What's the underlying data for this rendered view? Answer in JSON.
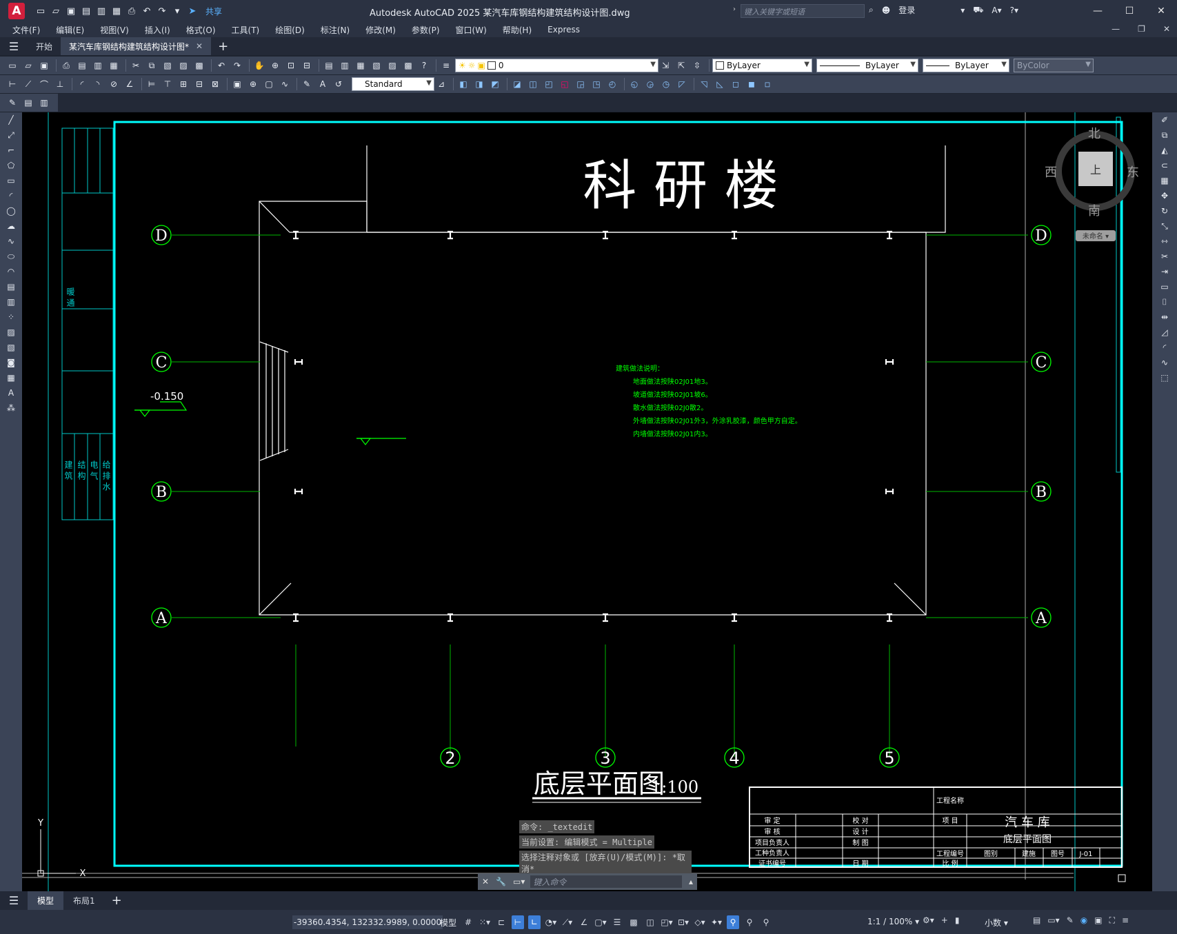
{
  "titlebar": {
    "app_logo": "A",
    "share_label": "共享",
    "title": "Autodesk AutoCAD 2025    某汽车库钢结构建筑结构设计图.dwg",
    "search_placeholder": "键入关键字或短语",
    "login_label": "登录"
  },
  "menu": [
    "文件(F)",
    "编辑(E)",
    "视图(V)",
    "插入(I)",
    "格式(O)",
    "工具(T)",
    "绘图(D)",
    "标注(N)",
    "修改(M)",
    "参数(P)",
    "窗口(W)",
    "帮助(H)",
    "Express"
  ],
  "tabs": {
    "start": "开始",
    "document": "某汽车库钢结构建筑结构设计图*"
  },
  "properties": {
    "layer": "0",
    "color": "ByLayer",
    "linetype": "ByLayer",
    "lineweight": "ByLayer",
    "plotstyle": "ByColor",
    "text_style": "Standard"
  },
  "drawing": {
    "building_name": "科 研 楼",
    "plan_title": "底层平面图",
    "plan_scale": "1:100",
    "elevation": "-0.150",
    "grid_rows": [
      "D",
      "C",
      "B",
      "A"
    ],
    "grid_cols": [
      "2",
      "3",
      "4",
      "5"
    ],
    "notes_title": "建筑做法说明：",
    "notes": [
      "地面做法按陕02J01地3。",
      "坡道做法按陕02J01坡6。",
      "散水做法按陕02J0散2。",
      "外墙做法按陕02J01外3，外涂乳胶漆，颜色甲方自定。",
      "内墙做法按陕02J01内3。"
    ],
    "left_strip_top": "暖 通",
    "left_strip_bottom": [
      "建 筑",
      "结 构",
      "电 气",
      "给 排 水"
    ],
    "title_block": {
      "project_label": "工程名称",
      "item_label": "项 目",
      "project_name": "汽 车 库",
      "drawing_name": "底层平面图",
      "number_label": "工程编号",
      "scale_label": "比 例",
      "cat_label": "图别",
      "cat_value": "建施",
      "no_label": "图号",
      "no_value": "J-01",
      "roles": [
        "审 定",
        "审 核",
        "项目负责人",
        "工种负责人",
        "证书编号"
      ],
      "roles2": [
        "校 对",
        "设 计",
        "制 图",
        "",
        "日 期"
      ]
    }
  },
  "viewcube": {
    "north": "北",
    "south": "南",
    "west": "西",
    "east": "东",
    "top": "上",
    "ucs": "未命名"
  },
  "command": {
    "history": [
      "命令: _textedit",
      "当前设置: 编辑模式 = Multiple",
      "选择注释对象或 [放弃(U)/模式(M)]: *取消*"
    ],
    "placeholder": "键入命令"
  },
  "layout_tabs": [
    "模型",
    "布局1"
  ],
  "status": {
    "coords": "-39360.4354, 132332.9989, 0.0000",
    "model": "模型",
    "scale": "1:1 / 100%",
    "units": "小数"
  },
  "colors": {
    "cyan": "#00ffff",
    "green": "#00ff00",
    "white": "#ffffff",
    "dark_green": "#1d8f1d"
  }
}
